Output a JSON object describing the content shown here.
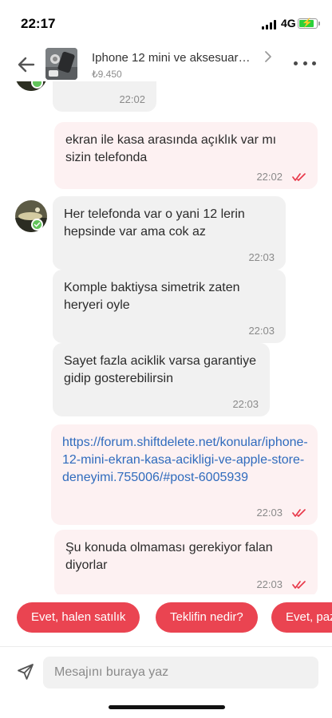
{
  "status_bar": {
    "time": "22:17",
    "network": "4G",
    "battery_level": 0.9
  },
  "header": {
    "listing_title": "Iphone 12 mini ve aksesuar…",
    "price": "₺9.450",
    "icons": {
      "back": "arrow-left-icon",
      "chevron": "chevron-right-icon",
      "more": "more-dots-icon"
    }
  },
  "messages": [
    {
      "direction": "incoming",
      "text": "",
      "time": "22:02"
    },
    {
      "direction": "outgoing",
      "text": "ekran ile kasa arasında açıklık var mı sizin telefonda",
      "time": "22:02",
      "status": "read"
    },
    {
      "direction": "incoming",
      "text": "Her telefonda var o yani 12 lerin hepsinde var ama cok az",
      "time": "22:03"
    },
    {
      "direction": "incoming",
      "text": "Komple baktiysa simetrik zaten heryeri oyle",
      "time": "22:03"
    },
    {
      "direction": "incoming",
      "text": "Sayet fazla aciklik varsa garantiye gidip gosterebilirsin",
      "time": "22:03"
    },
    {
      "direction": "outgoing",
      "text": "https://forum.shiftdelete.net/konular/iphone-12-mini-ekran-kasa-acikligi-ve-apple-store-deneyimi.755006/#post-6005939",
      "time": "22:03",
      "status": "read",
      "is_link": true
    },
    {
      "direction": "outgoing",
      "text": "Şu konuda olmaması gerekiyor falan diyorlar",
      "time": "22:03",
      "status": "read"
    }
  ],
  "quick_replies": [
    "Evet, halen satılık",
    "Teklifin nedir?",
    "Evet, pazarlık payı var"
  ],
  "composer": {
    "placeholder": "Mesajını buraya yaz",
    "value": ""
  },
  "colors": {
    "accent": "#ea4451",
    "outgoing_bubble": "#fdf1f2",
    "incoming_bubble": "#f1f1f1",
    "link": "#2f6bbd",
    "read_tick": "#e8394a",
    "online_badge": "#62c45a"
  }
}
